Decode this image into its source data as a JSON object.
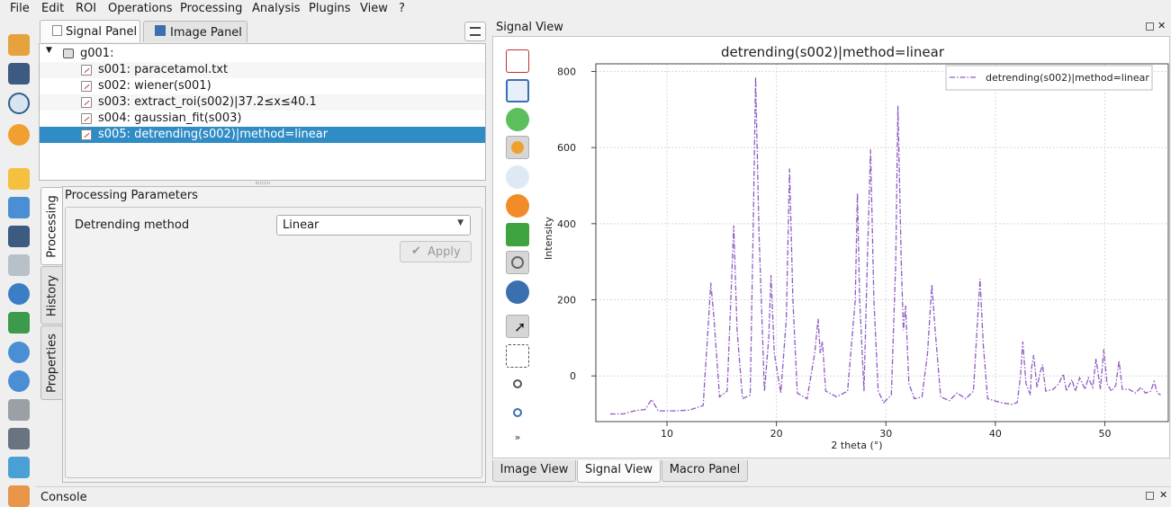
{
  "menu": [
    "File",
    "Edit",
    "ROI",
    "Operations",
    "Processing",
    "Analysis",
    "Plugins",
    "View",
    "?"
  ],
  "tabs": {
    "signal_panel": "Signal Panel",
    "image_panel": "Image Panel"
  },
  "tree": {
    "group": "g001:",
    "items": [
      "s001: paracetamol.txt",
      "s002: wiener(s001)",
      "s003: extract_roi(s002)|37.2≤x≤40.1",
      "s004: gaussian_fit(s003)",
      "s005: detrending(s002)|method=linear"
    ],
    "selected_index": 4
  },
  "side_tabs": [
    "Processing",
    "History",
    "Properties"
  ],
  "processing": {
    "section_title": "Processing Parameters",
    "method_label": "Detrending method",
    "method_value": "Linear",
    "apply_label": "Apply"
  },
  "signal_view": {
    "title": "Signal View"
  },
  "bottom_tabs": [
    "Image View",
    "Signal View",
    "Macro Panel"
  ],
  "console": {
    "title": "Console"
  },
  "chart_data": {
    "type": "line",
    "title": "detrending(s002)|method=linear",
    "xlabel": "2 theta (°)",
    "ylabel": "Intensity",
    "xlim": [
      3.5,
      55.8
    ],
    "ylim": [
      -120,
      820
    ],
    "xticks": [
      10,
      20,
      30,
      40,
      50
    ],
    "yticks": [
      0,
      200,
      400,
      600,
      800
    ],
    "grid": true,
    "legend_position": "top-right",
    "series": [
      {
        "name": "detrending(s002)|method=linear",
        "color": "#8e5bc2",
        "style": "dash-dot",
        "points": [
          [
            4.8,
            -100
          ],
          [
            6.0,
            -100
          ],
          [
            7.0,
            -92
          ],
          [
            8.0,
            -88
          ],
          [
            8.6,
            -62
          ],
          [
            9.2,
            -92
          ],
          [
            10.5,
            -92
          ],
          [
            12.0,
            -90
          ],
          [
            13.3,
            -78
          ],
          [
            13.8,
            150
          ],
          [
            14.0,
            245
          ],
          [
            14.3,
            150
          ],
          [
            14.8,
            -55
          ],
          [
            15.5,
            -40
          ],
          [
            15.9,
            250
          ],
          [
            16.1,
            395
          ],
          [
            16.4,
            120
          ],
          [
            16.9,
            -60
          ],
          [
            17.6,
            -50
          ],
          [
            17.9,
            430
          ],
          [
            18.1,
            785
          ],
          [
            18.4,
            380
          ],
          [
            18.9,
            -40
          ],
          [
            19.3,
            100
          ],
          [
            19.5,
            265
          ],
          [
            19.8,
            60
          ],
          [
            20.4,
            -45
          ],
          [
            20.9,
            150
          ],
          [
            21.2,
            545
          ],
          [
            21.5,
            200
          ],
          [
            21.9,
            -45
          ],
          [
            22.8,
            -60
          ],
          [
            23.5,
            60
          ],
          [
            23.8,
            150
          ],
          [
            24.0,
            60
          ],
          [
            24.2,
            90
          ],
          [
            24.5,
            -40
          ],
          [
            25.5,
            -55
          ],
          [
            26.5,
            -40
          ],
          [
            27.2,
            200
          ],
          [
            27.4,
            480
          ],
          [
            27.6,
            200
          ],
          [
            28.0,
            -40
          ],
          [
            28.3,
            300
          ],
          [
            28.6,
            595
          ],
          [
            28.9,
            200
          ],
          [
            29.3,
            -40
          ],
          [
            29.8,
            -70
          ],
          [
            30.5,
            -50
          ],
          [
            30.9,
            300
          ],
          [
            31.1,
            710
          ],
          [
            31.4,
            300
          ],
          [
            31.6,
            120
          ],
          [
            31.8,
            185
          ],
          [
            32.1,
            -20
          ],
          [
            32.6,
            -60
          ],
          [
            33.3,
            -55
          ],
          [
            33.8,
            60
          ],
          [
            34.2,
            240
          ],
          [
            34.5,
            120
          ],
          [
            35.0,
            -55
          ],
          [
            35.8,
            -65
          ],
          [
            36.5,
            -45
          ],
          [
            37.3,
            -60
          ],
          [
            38.0,
            -40
          ],
          [
            38.4,
            160
          ],
          [
            38.6,
            255
          ],
          [
            38.9,
            80
          ],
          [
            39.3,
            -60
          ],
          [
            40.5,
            -70
          ],
          [
            41.5,
            -75
          ],
          [
            42.0,
            -70
          ],
          [
            42.3,
            0
          ],
          [
            42.5,
            90
          ],
          [
            42.8,
            -20
          ],
          [
            43.2,
            -50
          ],
          [
            43.3,
            20
          ],
          [
            43.5,
            55
          ],
          [
            43.8,
            -30
          ],
          [
            44.1,
            10
          ],
          [
            44.3,
            30
          ],
          [
            44.6,
            -40
          ],
          [
            45.3,
            -35
          ],
          [
            45.8,
            -20
          ],
          [
            46.2,
            5
          ],
          [
            46.5,
            -40
          ],
          [
            47.0,
            -10
          ],
          [
            47.3,
            -40
          ],
          [
            47.7,
            -5
          ],
          [
            48.2,
            -35
          ],
          [
            48.5,
            -5
          ],
          [
            48.9,
            -30
          ],
          [
            49.2,
            45
          ],
          [
            49.6,
            -35
          ],
          [
            49.9,
            70
          ],
          [
            50.2,
            -20
          ],
          [
            50.6,
            -40
          ],
          [
            51.0,
            -25
          ],
          [
            51.3,
            40
          ],
          [
            51.6,
            -35
          ],
          [
            52.2,
            -35
          ],
          [
            52.8,
            -45
          ],
          [
            53.3,
            -30
          ],
          [
            53.7,
            -45
          ],
          [
            54.2,
            -40
          ],
          [
            54.5,
            -15
          ],
          [
            54.8,
            -45
          ],
          [
            55.1,
            -50
          ]
        ]
      }
    ]
  }
}
